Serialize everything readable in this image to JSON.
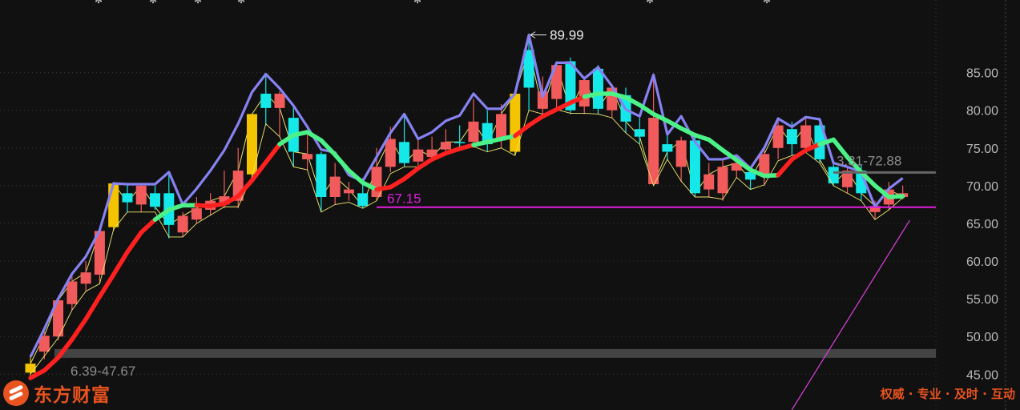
{
  "chart_data": {
    "type": "candlestick",
    "ylim": [
      44.5,
      92.5
    ],
    "yticks": [
      "85.00",
      "80.00",
      "75.00",
      "70.00",
      "65.00",
      "60.00",
      "55.00",
      "50.00",
      "45.00"
    ],
    "ytick_values": [
      85,
      80,
      75,
      70,
      65,
      60,
      55,
      50,
      45
    ],
    "candles": [
      {
        "o": 45.2,
        "c": 46.4,
        "h": 47.6,
        "l": 44.8,
        "color": "yellow"
      },
      {
        "o": 48.0,
        "c": 50.1,
        "h": 51.0,
        "l": 47.0,
        "color": "red"
      },
      {
        "o": 50.0,
        "c": 54.8,
        "h": 55.0,
        "l": 49.5,
        "color": "red"
      },
      {
        "o": 54.3,
        "c": 57.3,
        "h": 58.0,
        "l": 53.5,
        "color": "red"
      },
      {
        "o": 57.0,
        "c": 58.5,
        "h": 60.0,
        "l": 56.0,
        "color": "red"
      },
      {
        "o": 58.2,
        "c": 64.0,
        "h": 64.0,
        "l": 57.0,
        "color": "red"
      },
      {
        "o": 64.5,
        "c": 70.3,
        "h": 70.5,
        "l": 64.0,
        "color": "yellow"
      },
      {
        "o": 69.0,
        "c": 67.8,
        "h": 70.2,
        "l": 66.5,
        "color": "cyan"
      },
      {
        "o": 67.5,
        "c": 70.0,
        "h": 70.2,
        "l": 66.5,
        "color": "red"
      },
      {
        "o": 69.0,
        "c": 67.2,
        "h": 70.0,
        "l": 66.8,
        "color": "cyan"
      },
      {
        "o": 69.0,
        "c": 64.8,
        "h": 71.8,
        "l": 63.0,
        "color": "cyan"
      },
      {
        "o": 63.8,
        "c": 66.0,
        "h": 66.5,
        "l": 63.2,
        "color": "red"
      },
      {
        "o": 65.5,
        "c": 67.0,
        "h": 68.5,
        "l": 65.0,
        "color": "red"
      },
      {
        "o": 66.8,
        "c": 68.0,
        "h": 69.0,
        "l": 66.0,
        "color": "red"
      },
      {
        "o": 67.5,
        "c": 68.6,
        "h": 72.0,
        "l": 67.0,
        "color": "red"
      },
      {
        "o": 68.0,
        "c": 72.0,
        "h": 75.0,
        "l": 67.0,
        "color": "red"
      },
      {
        "o": 71.5,
        "c": 79.5,
        "h": 79.5,
        "l": 71.0,
        "color": "yellow"
      },
      {
        "o": 80.3,
        "c": 82.2,
        "h": 84.8,
        "l": 78.0,
        "color": "cyan"
      },
      {
        "o": 82.2,
        "c": 80.3,
        "h": 82.5,
        "l": 76.5,
        "color": "red"
      },
      {
        "o": 79.0,
        "c": 74.5,
        "h": 80.5,
        "l": 72.5,
        "color": "cyan"
      },
      {
        "o": 73.5,
        "c": 74.2,
        "h": 77.0,
        "l": 72.0,
        "color": "red"
      },
      {
        "o": 74.2,
        "c": 68.5,
        "h": 74.5,
        "l": 66.5,
        "color": "cyan"
      },
      {
        "o": 68.5,
        "c": 71.2,
        "h": 73.0,
        "l": 67.5,
        "color": "red"
      },
      {
        "o": 69.0,
        "c": 69.5,
        "h": 70.5,
        "l": 68.0,
        "color": "red"
      },
      {
        "o": 69.0,
        "c": 67.3,
        "h": 71.0,
        "l": 67.0,
        "color": "cyan"
      },
      {
        "o": 68.5,
        "c": 72.5,
        "h": 75.0,
        "l": 68.0,
        "color": "red"
      },
      {
        "o": 72.5,
        "c": 76.2,
        "h": 77.8,
        "l": 71.8,
        "color": "red"
      },
      {
        "o": 75.8,
        "c": 73.0,
        "h": 79.5,
        "l": 72.5,
        "color": "cyan"
      },
      {
        "o": 73.2,
        "c": 74.8,
        "h": 76.2,
        "l": 72.5,
        "color": "red"
      },
      {
        "o": 74.8,
        "c": 73.8,
        "h": 76.5,
        "l": 73.2,
        "color": "red"
      },
      {
        "o": 74.8,
        "c": 75.8,
        "h": 77.5,
        "l": 74.2,
        "color": "red"
      },
      {
        "o": 75.8,
        "c": 75.8,
        "h": 78.0,
        "l": 75.2,
        "color": "cyan"
      },
      {
        "o": 75.8,
        "c": 78.5,
        "h": 81.5,
        "l": 75.0,
        "color": "red"
      },
      {
        "o": 78.3,
        "c": 75.5,
        "h": 80.0,
        "l": 74.5,
        "color": "cyan"
      },
      {
        "o": 76.0,
        "c": 79.5,
        "h": 80.8,
        "l": 75.0,
        "color": "red"
      },
      {
        "o": 74.5,
        "c": 82.2,
        "h": 82.5,
        "l": 74.0,
        "color": "yellow"
      },
      {
        "o": 83.0,
        "c": 88.0,
        "h": 89.99,
        "l": 80.0,
        "color": "cyan"
      },
      {
        "o": 82.5,
        "c": 80.2,
        "h": 84.5,
        "l": 79.5,
        "color": "red"
      },
      {
        "o": 81.5,
        "c": 86.0,
        "h": 86.5,
        "l": 80.0,
        "color": "red"
      },
      {
        "o": 86.5,
        "c": 80.0,
        "h": 87.0,
        "l": 79.5,
        "color": "cyan"
      },
      {
        "o": 80.5,
        "c": 84.0,
        "h": 84.5,
        "l": 79.5,
        "color": "red"
      },
      {
        "o": 85.5,
        "c": 80.2,
        "h": 86.0,
        "l": 79.5,
        "color": "cyan"
      },
      {
        "o": 80.0,
        "c": 83.0,
        "h": 83.5,
        "l": 79.0,
        "color": "red"
      },
      {
        "o": 82.0,
        "c": 78.5,
        "h": 83.0,
        "l": 77.0,
        "color": "cyan"
      },
      {
        "o": 77.5,
        "c": 76.5,
        "h": 79.0,
        "l": 75.5,
        "color": "cyan"
      },
      {
        "o": 79.0,
        "c": 70.2,
        "h": 84.5,
        "l": 70.0,
        "color": "red"
      },
      {
        "o": 75.5,
        "c": 74.5,
        "h": 77.0,
        "l": 73.5,
        "color": "cyan"
      },
      {
        "o": 72.5,
        "c": 76.0,
        "h": 76.5,
        "l": 70.5,
        "color": "red"
      },
      {
        "o": 76.0,
        "c": 69.0,
        "h": 77.0,
        "l": 68.5,
        "color": "cyan"
      },
      {
        "o": 69.5,
        "c": 71.5,
        "h": 73.0,
        "l": 68.5,
        "color": "red"
      },
      {
        "o": 69.0,
        "c": 72.5,
        "h": 73.5,
        "l": 68.0,
        "color": "red"
      },
      {
        "o": 72.0,
        "c": 73.0,
        "h": 74.0,
        "l": 71.0,
        "color": "red"
      },
      {
        "o": 71.8,
        "c": 70.8,
        "h": 72.5,
        "l": 69.5,
        "color": "cyan"
      },
      {
        "o": 71.5,
        "c": 74.2,
        "h": 75.0,
        "l": 70.0,
        "color": "red"
      },
      {
        "o": 75.0,
        "c": 78.0,
        "h": 79.0,
        "l": 73.5,
        "color": "red"
      },
      {
        "o": 77.5,
        "c": 75.5,
        "h": 78.5,
        "l": 74.0,
        "color": "cyan"
      },
      {
        "o": 75.0,
        "c": 78.0,
        "h": 79.0,
        "l": 74.5,
        "color": "red"
      },
      {
        "o": 78.0,
        "c": 73.5,
        "h": 79.0,
        "l": 73.0,
        "color": "cyan"
      },
      {
        "o": 72.5,
        "c": 70.3,
        "h": 73.0,
        "l": 70.0,
        "color": "cyan"
      },
      {
        "o": 69.8,
        "c": 72.0,
        "h": 72.5,
        "l": 69.0,
        "color": "red"
      },
      {
        "o": 72.0,
        "c": 69.0,
        "h": 72.8,
        "l": 68.0,
        "color": "cyan"
      },
      {
        "o": 66.5,
        "c": 67.3,
        "h": 68.0,
        "l": 65.5,
        "color": "red"
      },
      {
        "o": 67.5,
        "c": 69.5,
        "h": 70.5,
        "l": 66.8,
        "color": "red"
      },
      {
        "o": 69.0,
        "c": 68.5,
        "h": 70.0,
        "l": 68.2,
        "color": "red"
      }
    ],
    "envelope_upper": [
      47.3,
      51.0,
      55.0,
      58.3,
      60.6,
      64.1,
      70.3,
      70.2,
      70.2,
      70.2,
      71.8,
      67.5,
      69.6,
      72.0,
      74.7,
      78.2,
      82.4,
      84.8,
      82.9,
      80.6,
      77.8,
      74.8,
      74.4,
      71.4,
      70.6,
      73.8,
      77.0,
      79.5,
      76.2,
      77.1,
      78.6,
      79.3,
      82.2,
      80.2,
      80.2,
      82.2,
      89.99,
      81.8,
      86.3,
      86.3,
      84.2,
      85.7,
      83.2,
      80.1,
      79.2,
      84.7,
      76.8,
      79.2,
      75.8,
      73.5,
      73.5,
      74.0,
      72.3,
      75.0,
      78.9,
      77.8,
      79.1,
      78.8,
      73.0,
      72.5,
      71.8,
      67.2,
      69.6,
      71.0
    ],
    "envelope_lower": [
      45.0,
      47.4,
      49.8,
      53.5,
      56.0,
      57.0,
      64.2,
      66.5,
      66.5,
      66.5,
      63.2,
      63.2,
      65.0,
      66.1,
      67.2,
      67.2,
      71.2,
      78.2,
      76.5,
      72.5,
      72.1,
      66.5,
      67.5,
      67.8,
      67.0,
      68.0,
      71.6,
      72.5,
      72.5,
      73.2,
      74.3,
      75.2,
      75.2,
      74.5,
      75.0,
      74.0,
      80.0,
      79.5,
      80.1,
      79.6,
      79.6,
      79.5,
      79.0,
      77.0,
      75.5,
      70.0,
      73.5,
      70.6,
      68.5,
      68.5,
      68.2,
      71.1,
      69.5,
      70.1,
      73.3,
      74.0,
      74.4,
      73.0,
      70.0,
      69.0,
      68.0,
      65.5,
      66.8,
      68.4
    ],
    "trend_line": [
      44.5,
      45.5,
      47.2,
      49.6,
      52.3,
      55.3,
      58.2,
      61.2,
      63.8,
      65.5,
      66.8,
      67.4,
      67.4,
      67.3,
      67.6,
      68.6,
      70.7,
      73.1,
      75.5,
      76.7,
      77.1,
      76.0,
      74.1,
      72.0,
      70.4,
      69.5,
      69.8,
      70.9,
      72.3,
      73.5,
      74.3,
      74.9,
      75.4,
      75.8,
      76.2,
      76.6,
      78.0,
      79.2,
      80.1,
      81.0,
      81.8,
      82.2,
      82.2,
      81.7,
      80.7,
      79.5,
      78.6,
      77.6,
      76.7,
      76.1,
      74.7,
      73.4,
      72.1,
      71.3,
      71.4,
      73.5,
      74.7,
      75.5,
      76.1,
      73.8,
      71.8,
      70.0,
      68.5,
      68.6
    ],
    "trend_colors": [
      "red",
      "red",
      "red",
      "red",
      "red",
      "red",
      "red",
      "red",
      "red",
      "green",
      "green",
      "green",
      "red",
      "red",
      "red",
      "red",
      "red",
      "red",
      "green",
      "green",
      "green",
      "green",
      "green",
      "green",
      "green",
      "red",
      "red",
      "red",
      "red",
      "red",
      "red",
      "red",
      "green",
      "green",
      "green",
      "red",
      "red",
      "red",
      "red",
      "red",
      "green",
      "green",
      "green",
      "green",
      "green",
      "green",
      "green",
      "green",
      "green",
      "green",
      "green",
      "green",
      "green",
      "green",
      "red",
      "red",
      "red",
      "green",
      "green",
      "green",
      "green",
      "green",
      "green",
      "green"
    ],
    "long_ma": {
      "start": [
        55,
        40.3
      ],
      "end": [
        63.5,
        65.4
      ]
    },
    "horizontal_lines": [
      {
        "value": 67.15,
        "label": "67.15",
        "color": "#e21ee0"
      },
      {
        "value": 73.35,
        "label": "3.31-72.88",
        "color": "#7a7a7a"
      },
      {
        "value": 47.7,
        "label": "6.39-47.67",
        "color": "#6e6e6e"
      }
    ],
    "annotation_high": {
      "value": 89.99,
      "label": "89.99"
    },
    "colors": {
      "up": "#f25b5b",
      "down": "#14e8e8",
      "limit_up": "#f5c400",
      "envelope": "#8682f2",
      "trend_up": "#ff2020",
      "trend_down": "#4cf287",
      "long_ma": "#e040e0",
      "thin": "#e8e46a"
    }
  },
  "brand": {
    "name": "东方财富",
    "slogan": "权威 · 专业 · 及时 · 互动"
  }
}
